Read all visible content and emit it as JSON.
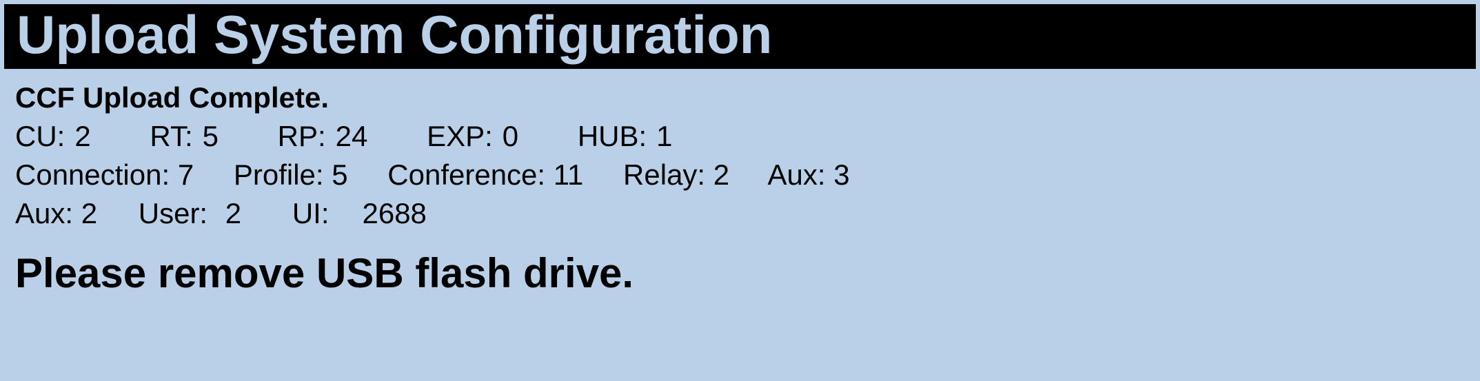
{
  "header": {
    "title": "Upload System Configuration"
  },
  "status": {
    "message": "CCF Upload Complete."
  },
  "row1": {
    "cu_label": "CU:",
    "cu_value": "2",
    "rt_label": "RT:",
    "rt_value": "5",
    "rp_label": "RP:",
    "rp_value": "24",
    "exp_label": "EXP:",
    "exp_value": "0",
    "hub_label": "HUB:",
    "hub_value": "1"
  },
  "row2": {
    "connection_label": "Connection:",
    "connection_value": "7",
    "profile_label": "Profile:",
    "profile_value": "5",
    "conference_label": "Conference:",
    "conference_value": "11",
    "relay_label": "Relay:",
    "relay_value": "2",
    "aux_label": "Aux:",
    "aux_value": "3"
  },
  "row3": {
    "aux_label": "Aux:",
    "aux_value": "2",
    "user_label": "User:",
    "user_value": "2",
    "ui_label": "UI:",
    "ui_value": "2688"
  },
  "footer": {
    "message": "Please remove USB flash drive."
  }
}
